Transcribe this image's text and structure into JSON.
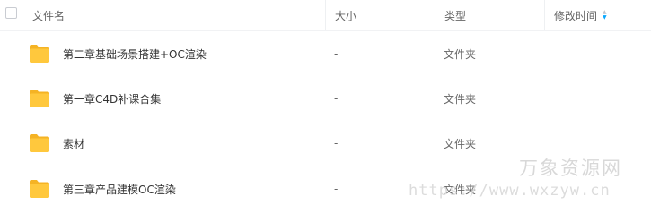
{
  "header": {
    "name_label": "文件名",
    "size_label": "大小",
    "type_label": "类型",
    "modified_label": "修改时间"
  },
  "files": [
    {
      "name": "第二章基础场景搭建+OC渲染",
      "size": "-",
      "type": "文件夹"
    },
    {
      "name": "第一章C4D补课合集",
      "size": "-",
      "type": "文件夹"
    },
    {
      "name": "素材",
      "size": "-",
      "type": "文件夹"
    },
    {
      "name": "第三章产品建模OC渲染",
      "size": "-",
      "type": "文件夹"
    }
  ],
  "watermark": {
    "title": "万象资源网",
    "url": "https://www.wxzyw.cn"
  },
  "colors": {
    "folder": "#ffc83d",
    "folder_dark": "#f5b324",
    "sort_active": "#06a7ff"
  },
  "icons": {
    "folder": "folder-icon",
    "sort": "sort-arrow-icon",
    "checkbox": "checkbox-icon"
  }
}
